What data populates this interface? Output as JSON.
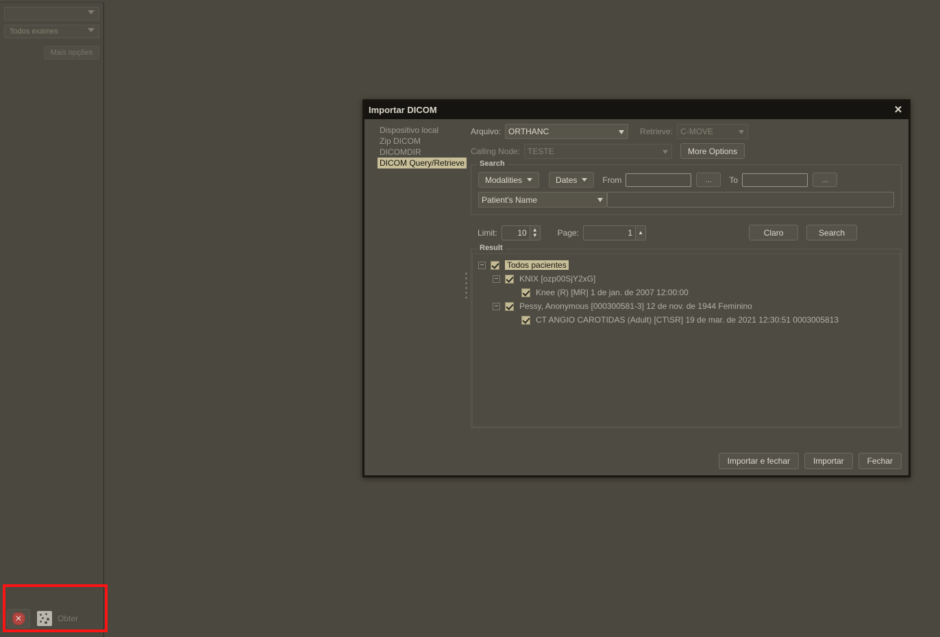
{
  "background_app": {
    "filter_combo_value": "",
    "exams_combo_value": "Todos exames",
    "more_options_label": "Mais opções",
    "bottom_bar": {
      "cancel_icon": "cancel-octagon-icon",
      "cancel_glyph": "✕",
      "get_icon": "dice-icon",
      "get_label": "Obter",
      "highlight_color": "#fb1414"
    }
  },
  "dialog": {
    "title": "Importar DICOM",
    "close_glyph": "✕",
    "sources": [
      {
        "label": "Dispositivo local",
        "selected": false
      },
      {
        "label": "Zip DICOM",
        "selected": false
      },
      {
        "label": "DICOMDIR",
        "selected": false
      },
      {
        "label": "DICOM Query/Retrieve",
        "selected": true
      }
    ],
    "connection": {
      "arquivo_label": "Arquivo:",
      "arquivo_value": "ORTHANC",
      "arquivo_options": [
        "ORTHANC"
      ],
      "retrieve_label": "Retrieve:",
      "retrieve_value": "C-MOVE",
      "retrieve_options": [
        "C-MOVE"
      ],
      "calling_node_label": "Calling Node:",
      "calling_node_value": "TESTE",
      "calling_node_options": [
        "TESTE"
      ],
      "more_options_label": "More Options"
    },
    "search": {
      "title": "Search",
      "modalities_label": "Modalities",
      "dates_label": "Dates",
      "from_label": "From",
      "from_value": "",
      "from_browse_label": "...",
      "to_label": "To",
      "to_value": "",
      "to_browse_label": "...",
      "criteria_value": "Patient's Name",
      "criteria_options": [
        "Patient's Name"
      ],
      "criteria_text_value": "",
      "limit_label": "Limit:",
      "limit_value": "10",
      "page_label": "Page:",
      "page_value": "1",
      "clear_label": "Claro",
      "search_label": "Search"
    },
    "result": {
      "title": "Result",
      "splitter_icon": "splitter-dots-icon",
      "tree": [
        {
          "indent": 0,
          "expander": "minus",
          "checked": true,
          "label": "Todos pacientes",
          "selected": true
        },
        {
          "indent": 1,
          "expander": "minus",
          "checked": true,
          "label": "KNIX [ozp00SjY2xG]",
          "selected": false
        },
        {
          "indent": 2,
          "expander": "none",
          "checked": true,
          "label": "Knee (R) [MR] 1 de jan. de 2007 12:00:00",
          "selected": false
        },
        {
          "indent": 1,
          "expander": "minus",
          "checked": true,
          "label": "Pessy, Anonymous [000300581-3] 12 de nov. de 1944 Feminino",
          "selected": false
        },
        {
          "indent": 2,
          "expander": "none",
          "checked": true,
          "label": "CT ANGIO CAROTIDAS (Adult) [CT\\SR] 19 de mar. de 2021 12:30:51 0003005813",
          "selected": false
        }
      ]
    },
    "footer": {
      "import_and_close_label": "Importar e fechar",
      "import_label": "Importar",
      "close_label": "Fechar"
    }
  },
  "colors": {
    "window_bg": "#4b483f",
    "dialog_bg": "#4e4b42",
    "titlebar_bg": "#161410",
    "selection_bg": "#c8bf99",
    "text": "#bdbaaf",
    "highlight_red": "#fb1414"
  }
}
